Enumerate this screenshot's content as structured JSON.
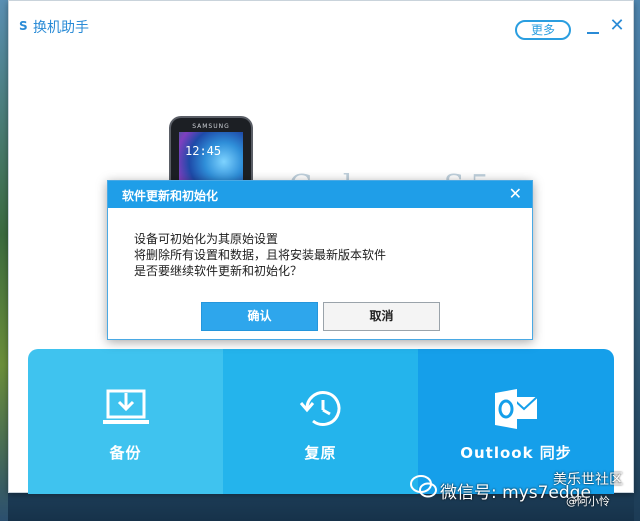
{
  "app": {
    "logo_text": "S",
    "title": "换机助手",
    "more_label": "更多",
    "close_glyph": "✕"
  },
  "device": {
    "phone_brand": "SAMSUNG",
    "phone_time": "12:45",
    "name": "Galaxy S5"
  },
  "tiles": [
    {
      "label": "备份",
      "icon": "download-to-laptop-icon"
    },
    {
      "label": "复原",
      "icon": "restore-clock-icon"
    },
    {
      "label": "Outlook 同步",
      "icon": "outlook-icon"
    }
  ],
  "dialog": {
    "title": "软件更新和初始化",
    "close_glyph": "✕",
    "lines": [
      "设备可初始化为其原始设置",
      "将删除所有设置和数据，且将安装最新版本软件",
      "是否要继续软件更新和初始化？"
    ],
    "ok_label": "确认",
    "cancel_label": "取消"
  },
  "watermark": {
    "site": "美乐世社区",
    "account": "微信号: mys7edge",
    "author": "@阿小怜"
  },
  "colors": {
    "accent": "#2a9ee0",
    "dialog_header": "#1f9ee8",
    "tile_1": "#3fc3ef",
    "tile_2": "#24b4ec",
    "tile_3": "#159fea"
  }
}
